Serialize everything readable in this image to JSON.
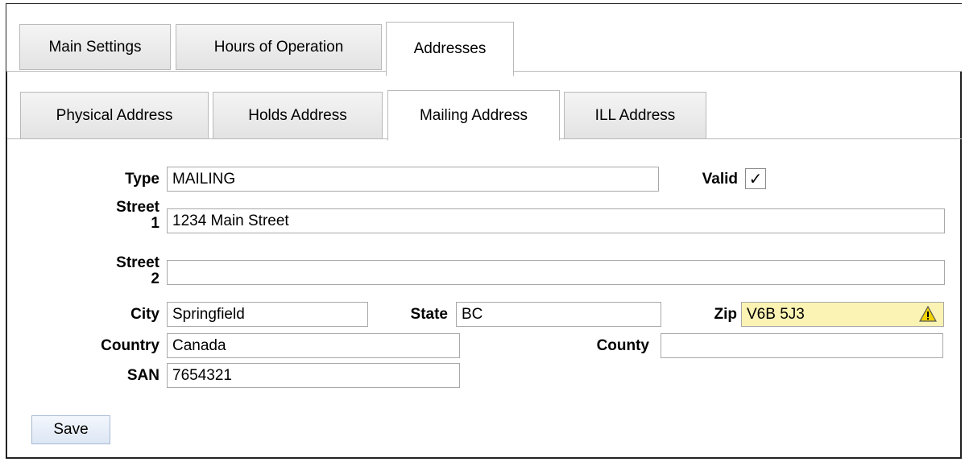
{
  "tabs": {
    "main_settings": "Main Settings",
    "hours_of_operation": "Hours of Operation",
    "addresses": "Addresses"
  },
  "address_tabs": {
    "physical": "Physical Address",
    "holds": "Holds Address",
    "mailing": "Mailing Address",
    "ill": "ILL Address"
  },
  "form": {
    "type_label": "Type",
    "type_value": "MAILING",
    "valid_label": "Valid",
    "valid_checked": "✓",
    "street1_label_a": "Street",
    "street1_label_b": "1",
    "street1_value": "1234 Main Street",
    "street2_label_a": "Street",
    "street2_label_b": "2",
    "street2_value": "",
    "city_label": "City",
    "city_value": "Springfield",
    "state_label": "State",
    "state_value": "BC",
    "zip_label": "Zip",
    "zip_value": "V6B 5J3",
    "country_label": "Country",
    "country_value": "Canada",
    "county_label": "County",
    "county_value": "",
    "san_label": "SAN",
    "san_value": "7654321"
  },
  "actions": {
    "save_label": "Save"
  },
  "colors": {
    "zip_warning_bg": "#fbf3b3",
    "warning_icon": "#f2d300"
  },
  "icons": {
    "zip_warning": "warning-triangle-icon",
    "valid_check": "checkmark-icon"
  }
}
